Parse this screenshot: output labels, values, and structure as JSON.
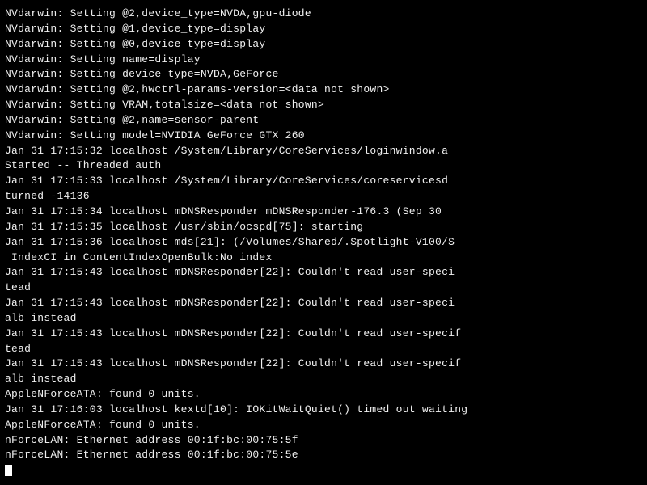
{
  "terminal": {
    "lines": [
      "NVdarwin: Setting @2,device_type=NVDA,gpu-diode",
      "NVdarwin: Setting @1,device_type=display",
      "NVdarwin: Setting @0,device_type=display",
      "NVdarwin: Setting name=display",
      "NVdarwin: Setting device_type=NVDA,GeForce",
      "NVdarwin: Setting @2,hwctrl-params-version=<data not shown>",
      "NVdarwin: Setting VRAM,totalsize=<data not shown>",
      "NVdarwin: Setting @2,name=sensor-parent",
      "NVdarwin: Setting model=NVIDIA GeForce GTX 260",
      "Jan 31 17:15:32 localhost /System/Library/CoreServices/loginwindow.a",
      "Started -- Threaded auth",
      "Jan 31 17:15:33 localhost /System/Library/CoreServices/coreservicesd",
      "turned -14136",
      "Jan 31 17:15:34 localhost mDNSResponder mDNSResponder-176.3 (Sep 30",
      "Jan 31 17:15:35 localhost /usr/sbin/ocspd[75]: starting",
      "Jan 31 17:15:36 localhost mds[21]: (/Volumes/Shared/.Spotlight-V100/S",
      " IndexCI in ContentIndexOpenBulk:No index",
      "Jan 31 17:15:43 localhost mDNSResponder[22]: Couldn't read user-speci",
      "tead",
      "Jan 31 17:15:43 localhost mDNSResponder[22]: Couldn't read user-speci",
      "alb instead",
      "Jan 31 17:15:43 localhost mDNSResponder[22]: Couldn't read user-specif",
      "tead",
      "Jan 31 17:15:43 localhost mDNSResponder[22]: Couldn't read user-specif",
      "alb instead",
      "AppleNForceATA: found 0 units.",
      "Jan 31 17:16:03 localhost kextd[10]: IOKitWaitQuiet() timed out waiting",
      "AppleNForceATA: found 0 units.",
      "nForceLAN: Ethernet address 00:1f:bc:00:75:5f",
      "nForceLAN: Ethernet address 00:1f:bc:00:75:5e"
    ]
  }
}
